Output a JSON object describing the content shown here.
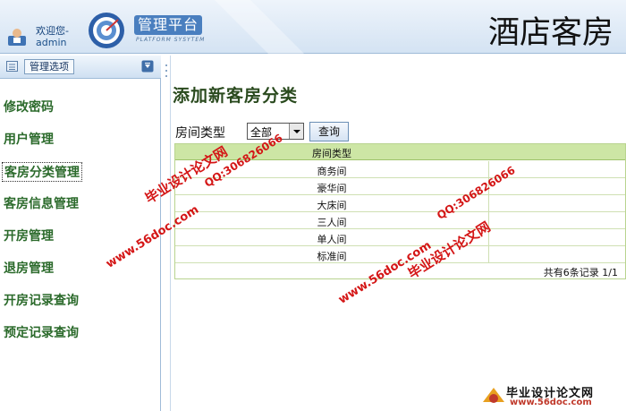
{
  "header": {
    "welcome": "欢迎您-",
    "username": "admin",
    "brand_cn": "管理平台",
    "brand_en": "PLATFORM SYSYTEM",
    "site_title": "酒店客房"
  },
  "sidebar": {
    "header_label": "管理选项",
    "items": [
      {
        "label": "修改密码"
      },
      {
        "label": "用户管理"
      },
      {
        "label": "客房分类管理"
      },
      {
        "label": "客房信息管理"
      },
      {
        "label": "开房管理"
      },
      {
        "label": "退房管理"
      },
      {
        "label": "开房记录查询"
      },
      {
        "label": "预定记录查询"
      }
    ],
    "active_index": 2
  },
  "main": {
    "title": "添加新客房分类",
    "filter": {
      "label": "房间类型",
      "selected": "全部",
      "button": "查询"
    },
    "table": {
      "header": "房间类型",
      "rows": [
        "商务间",
        "豪华间",
        "大床间",
        "三人间",
        "单人间",
        "标准间"
      ],
      "pager": "共有6条记录  1/1"
    }
  },
  "watermarks": {
    "site_cn": "毕业设计论文网",
    "qq": "QQ:306826066",
    "url": "www.56doc.com"
  },
  "corner_logo": {
    "title": "毕业设计论文网",
    "url": "www.56doc.com"
  },
  "colors": {
    "accent": "#4a7fbf",
    "nav_text": "#2b6a2b",
    "table_header": "#cde6a5",
    "watermark": "#d41616"
  }
}
